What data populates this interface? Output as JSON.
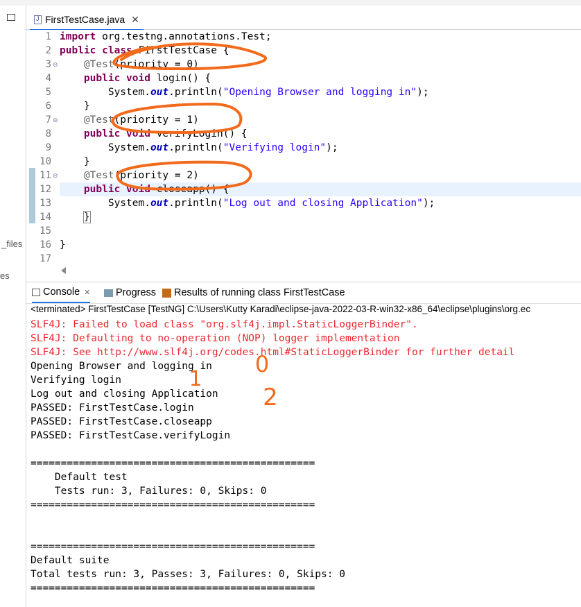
{
  "left_panel": {
    "labels": [
      "_files",
      "es"
    ]
  },
  "editor": {
    "tab_label": "FirstTestCase.java",
    "line_numbers": [
      "1",
      "2",
      "3",
      "4",
      "5",
      "6",
      "7",
      "8",
      "9",
      "10",
      "11",
      "12",
      "13",
      "14",
      "15",
      "16",
      "17"
    ]
  },
  "console_panel": {
    "tabs": [
      {
        "label": "Console"
      },
      {
        "label": "Progress"
      },
      {
        "label": "Results of running class FirstTestCase"
      }
    ],
    "terminated": "<terminated> FirstTestCase [TestNG] C:\\Users\\Kutty Karadi\\eclipse-java-2022-03-R-win32-x86_64\\eclipse\\plugins\\org.ec",
    "lines": [
      {
        "text": "SLF4J: Failed to load class \"org.slf4j.impl.StaticLoggerBinder\".",
        "type": "err"
      },
      {
        "text": "SLF4J: Defaulting to no-operation (NOP) logger implementation",
        "type": "err"
      },
      {
        "text": "SLF4J: See http://www.slf4j.org/codes.html#StaticLoggerBinder for further detail",
        "type": "err"
      },
      {
        "text": "Opening Browser and logging in",
        "type": "out"
      },
      {
        "text": "Verifying login",
        "type": "out"
      },
      {
        "text": "Log out and closing Application",
        "type": "out"
      },
      {
        "text": "PASSED: FirstTestCase.login",
        "type": "out"
      },
      {
        "text": "PASSED: FirstTestCase.closeapp",
        "type": "out"
      },
      {
        "text": "PASSED: FirstTestCase.verifyLogin",
        "type": "out"
      },
      {
        "text": "",
        "type": "out"
      },
      {
        "text": "===============================================",
        "type": "out"
      },
      {
        "text": "    Default test",
        "type": "out"
      },
      {
        "text": "    Tests run: 3, Failures: 0, Skips: 0",
        "type": "out"
      },
      {
        "text": "===============================================",
        "type": "out"
      },
      {
        "text": "",
        "type": "out"
      },
      {
        "text": "",
        "type": "out"
      },
      {
        "text": "===============================================",
        "type": "out"
      },
      {
        "text": "Default suite",
        "type": "out"
      },
      {
        "text": "Total tests run: 3, Passes: 3, Failures: 0, Skips: 0",
        "type": "out"
      },
      {
        "text": "===============================================",
        "type": "out"
      }
    ]
  },
  "code": {
    "l1_kw": "import",
    "l1_rest": " org.testng.annotations.Test;",
    "l2_kw1": "public",
    "l2_kw2": "class",
    "l2_rest": " FirstTestCase {",
    "l3_ann": "@Test",
    "l3_rest": "(priority = 0)",
    "l4_kw1": "public",
    "l4_kw2": "void",
    "l4_rest": " login() {",
    "l5_sys": "System.",
    "l5_out": "out",
    "l5_mid": ".println(",
    "l5_str": "\"Opening Browser and logging in\"",
    "l5_end": ");",
    "l6": "}",
    "l7_ann": "@Test",
    "l7_rest": "(priority = 1)",
    "l8_kw1": "public",
    "l8_kw2": "void",
    "l8_rest": " verifyLogin() {",
    "l9_sys": "System.",
    "l9_out": "out",
    "l9_mid": ".println(",
    "l9_str": "\"Verifying login\"",
    "l9_end": ");",
    "l10": "}",
    "l11_ann": "@Test",
    "l11_rest": "(priority = 2)",
    "l12_kw1": "public",
    "l12_kw2": "void",
    "l12_rest": " closeapp() {",
    "l13_sys": "System.",
    "l13_out": "out",
    "l13_mid": ".println(",
    "l13_str": "\"Log out and closing Application\"",
    "l13_end": ");",
    "l14": "}",
    "l16": "}"
  },
  "handwritten_annotations": {
    "digits": [
      "0",
      "1",
      "2"
    ],
    "color": "#f26a1b"
  },
  "colors": {
    "keyword": "#7f0055",
    "string": "#2a00ff",
    "error": "#e8282f",
    "accent": "#1a73e8"
  }
}
